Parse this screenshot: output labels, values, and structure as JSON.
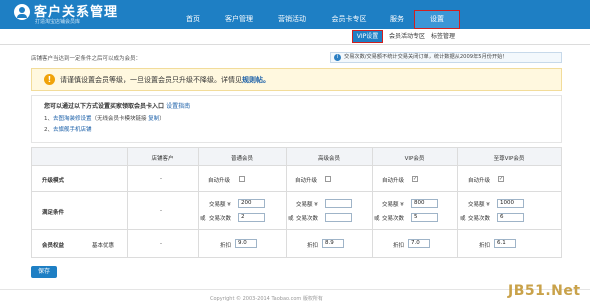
{
  "header": {
    "app_title": "客户关系管理",
    "app_subtitle": "打造淘宝店铺会员库",
    "nav": [
      {
        "label": "首页"
      },
      {
        "label": "客户管理"
      },
      {
        "label": "营销活动"
      },
      {
        "label": "会员卡专区"
      },
      {
        "label": "服务"
      },
      {
        "label": "设置",
        "active": true
      }
    ]
  },
  "subnav": [
    {
      "label": "VIP设置",
      "active": true
    },
    {
      "label": "会员活动专区"
    },
    {
      "label": "标签管理"
    }
  ],
  "intro": "店铺客户当达到一定条件之后可以成为会员：",
  "notice": {
    "icon": "info-icon",
    "text": "交易次数/交易额不统计交易关闭订单，统计数据从2009年5月份开始！"
  },
  "warning": {
    "icon": "warning-icon",
    "text": "请谨慎设置会员等级，一旦设置会员只升级不降级。详情见",
    "link": "规则帖。"
  },
  "guide": {
    "title": "您可以通过以下方式设置买家领取会员卡入口",
    "title_link": "设置指南",
    "line1_prefix": "1、",
    "line1_link": "去图淘装修设置",
    "line1_text": "（无线会员卡模块链接",
    "line1_link2": "复制",
    "line1_suffix": "）",
    "line2_prefix": "2、",
    "line2_link": "去旗舰手机店铺"
  },
  "table": {
    "headers": [
      "店铺客户",
      "普通会员",
      "高级会员",
      "VIP会员",
      "至尊VIP会员"
    ],
    "upgrade_row": {
      "label": "升级模式",
      "shop_value": "-",
      "auto_label": "自动升级"
    },
    "condition_row": {
      "label": "满足条件",
      "shop_value": "-",
      "amount_label": "交易额 ¥",
      "or_label": "或",
      "count_label": "交易次数",
      "levels": [
        {
          "amount": "200",
          "count": "2",
          "checked": false
        },
        {
          "amount": "",
          "count": "",
          "checked": false
        },
        {
          "amount": "800",
          "count": "5",
          "checked": true
        },
        {
          "amount": "1000",
          "count": "6",
          "checked": true
        }
      ]
    },
    "benefit_row": {
      "label": "会员权益",
      "sublabel": "基本优惠",
      "shop_value": "-",
      "discount_label": "折扣",
      "discounts": [
        "9.0",
        "8.9",
        "7.0",
        "6.1"
      ]
    }
  },
  "save_label": "保存",
  "copyright": "Copyright © 2003-2014 Taobao.com 版权所有",
  "watermark": "JB51.Net"
}
